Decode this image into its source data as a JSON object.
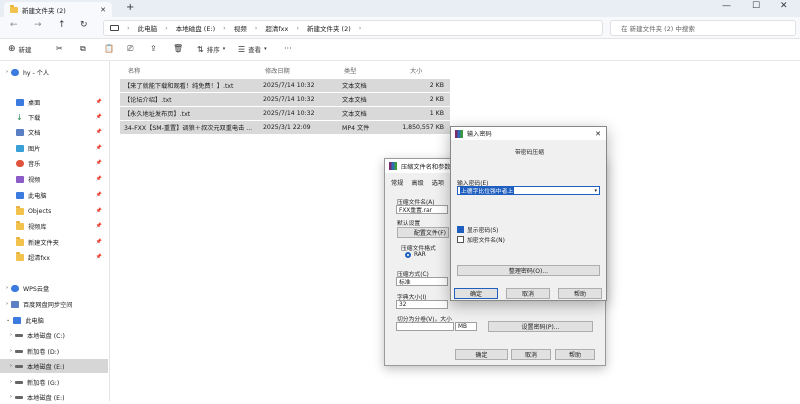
{
  "titlebar": {
    "tab_title": "新建文件夹 (2)",
    "close": "✕",
    "new_tab": "+",
    "minimize": "—",
    "maximize": "☐",
    "close_window": "✕"
  },
  "nav": {
    "back": "←",
    "forward": "→",
    "up": "↑",
    "refresh": "↻"
  },
  "breadcrumb": [
    "此电脑",
    "本地磁盘 (E:)",
    "视频",
    "超清fxx",
    "新建文件夹 (2)"
  ],
  "search": {
    "placeholder": "在 新建文件夹 (2) 中搜索"
  },
  "commandbar": {
    "new": "新建",
    "sort": "排序",
    "view": "查看",
    "more": "···"
  },
  "sidebar": {
    "user": "hy - 个人",
    "items": [
      {
        "label": "桌面",
        "color": "#3b7be0"
      },
      {
        "label": "下载",
        "color": "#2e8b57"
      },
      {
        "label": "文档",
        "color": "#5a7fc4"
      },
      {
        "label": "图片",
        "color": "#3aa0d8"
      },
      {
        "label": "音乐",
        "color": "#e0533d"
      },
      {
        "label": "视频",
        "color": "#8b5cc7"
      },
      {
        "label": "此电脑",
        "color": "#3b7be0"
      },
      {
        "label": "Objects",
        "color": "#f3c24d"
      },
      {
        "label": "视频库",
        "color": "#f3c24d"
      },
      {
        "label": "新建文件夹",
        "color": "#f3c24d"
      },
      {
        "label": "超清fxx",
        "color": "#f3c24d"
      }
    ],
    "cloud": "WPS云盘",
    "baidu": "百度网盘同步空间",
    "thispc": "此电脑",
    "drives": [
      "本地磁盘 (C:)",
      "新加卷 (D:)",
      "本地磁盘 (E:)",
      "新加卷 (G:)",
      "本地磁盘 (E:)"
    ]
  },
  "filelist": {
    "headers": {
      "name": "名称",
      "date": "修改日期",
      "type": "类型",
      "size": "大小"
    },
    "rows": [
      {
        "name": "【来了就能下载和观看！纯免费！】.txt",
        "date": "2025/7/14 10:32",
        "type": "文本文档",
        "size": "2 KB"
      },
      {
        "name": "【论坛介绍】.txt",
        "date": "2025/7/14 10:32",
        "type": "文本文档",
        "size": "2 KB"
      },
      {
        "name": "【永久地址发布页】.txt",
        "date": "2025/7/14 10:32",
        "type": "文本文档",
        "size": "1 KB"
      },
      {
        "name": "34-FXX【SM-重置】调狼＋叔次元双重电击 ...",
        "date": "2025/3/1 22:09",
        "type": "MP4 文件",
        "size": "1,850,557 KB"
      }
    ]
  },
  "archive_dialog": {
    "title": "压缩文件名和参数",
    "tabs": [
      "常规",
      "高级",
      "选项"
    ],
    "archive_name_label": "压缩文件名(A)",
    "archive_name": "FXX重置.rar",
    "default_profile": "默认设置",
    "profiles_button": "配置文件(F)",
    "format_label": "压缩文件格式",
    "format_value": "RAR",
    "method_label": "压缩方式(C)",
    "method_value": "标准",
    "dict_label": "字典大小(I)",
    "dict_value": "32",
    "split_label": "切分为分卷(V)，大小",
    "split_unit": "MB",
    "set_password": "设置密码(P)...",
    "ok": "确定",
    "cancel": "取消",
    "help": "帮助"
  },
  "password_dialog": {
    "title": "输入密码",
    "subtitle": "带密码压缩",
    "enter_label": "输入密码(E)",
    "password_value": "上德字比位强中者上",
    "show_password": "显示密码(S)",
    "encrypt_names": "加密文件名(N)",
    "organize": "整理密码(O)...",
    "ok": "确定",
    "cancel": "取消",
    "help": "帮助"
  }
}
